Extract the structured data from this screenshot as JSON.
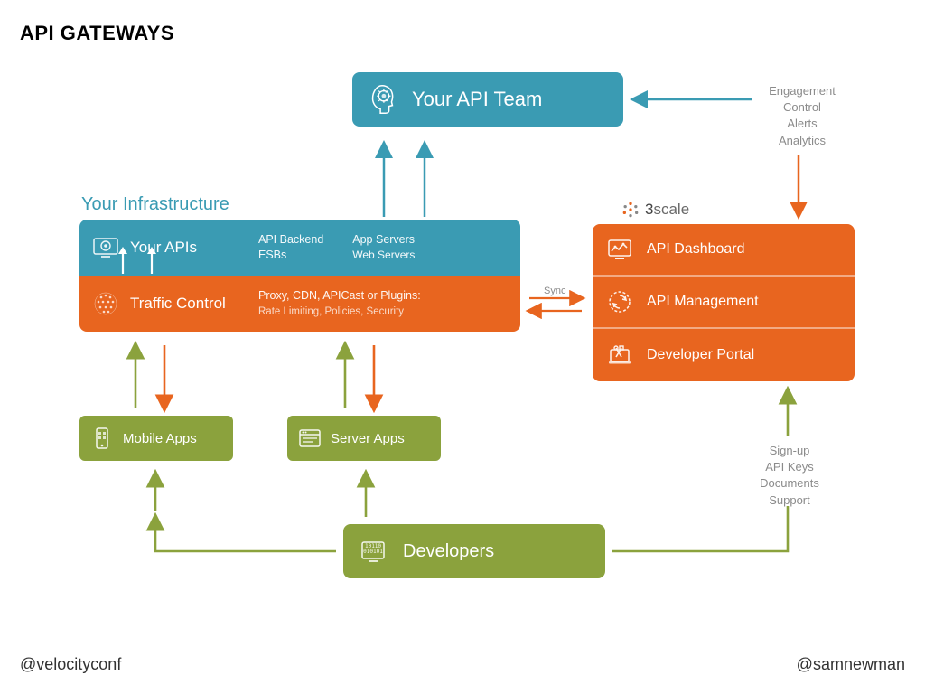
{
  "title": "API GATEWAYS",
  "footer_left": "@velocityconf",
  "footer_right": "@samnewman",
  "api_team": {
    "label": "Your API Team"
  },
  "infra_label": "Your Infrastructure",
  "infra": {
    "apis": {
      "label": "Your APIs",
      "sub1": "API Backend",
      "sub2": "ESBs",
      "sub3": "App Servers",
      "sub4": "Web Servers"
    },
    "traffic": {
      "label": "Traffic Control",
      "sub1": "Proxy, CDN, APICast or Plugins:",
      "sub2": "Rate Limiting, Policies, Security"
    }
  },
  "brand": {
    "name_a": "3",
    "name_b": "scale"
  },
  "panel": {
    "dashboard": "API Dashboard",
    "management": "API Management",
    "portal": "Developer Portal"
  },
  "apps": {
    "mobile": "Mobile Apps",
    "server": "Server Apps"
  },
  "developers": "Developers",
  "annot": {
    "engagement": "Engagement\nControl\nAlerts\nAnalytics",
    "signup": "Sign-up\nAPI Keys\nDocuments\nSupport"
  },
  "sync": "Sync"
}
